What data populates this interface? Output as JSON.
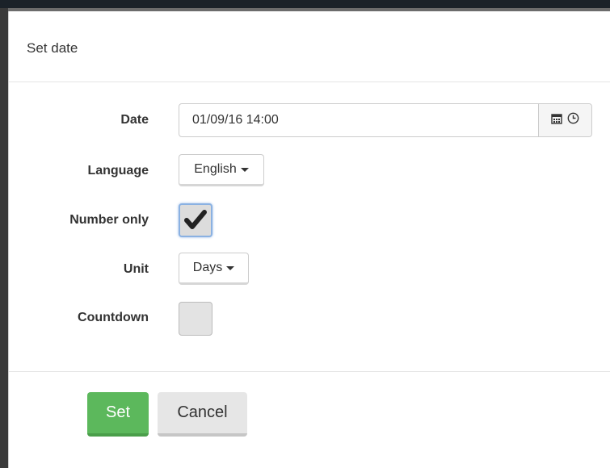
{
  "modal": {
    "title": "Set date"
  },
  "form": {
    "date": {
      "label": "Date",
      "value": "01/09/16 14:00",
      "calendar_icon": "calendar-icon",
      "clock_icon": "clock-icon"
    },
    "language": {
      "label": "Language",
      "selected": "English"
    },
    "number_only": {
      "label": "Number only",
      "checked": true
    },
    "unit": {
      "label": "Unit",
      "selected": "Days"
    },
    "countdown": {
      "label": "Countdown",
      "checked": false
    }
  },
  "footer": {
    "set_label": "Set",
    "cancel_label": "Cancel"
  },
  "colors": {
    "set_button": "#5cb85c",
    "cancel_button": "#e6e6e6",
    "focus_ring": "#8ab1e2"
  }
}
